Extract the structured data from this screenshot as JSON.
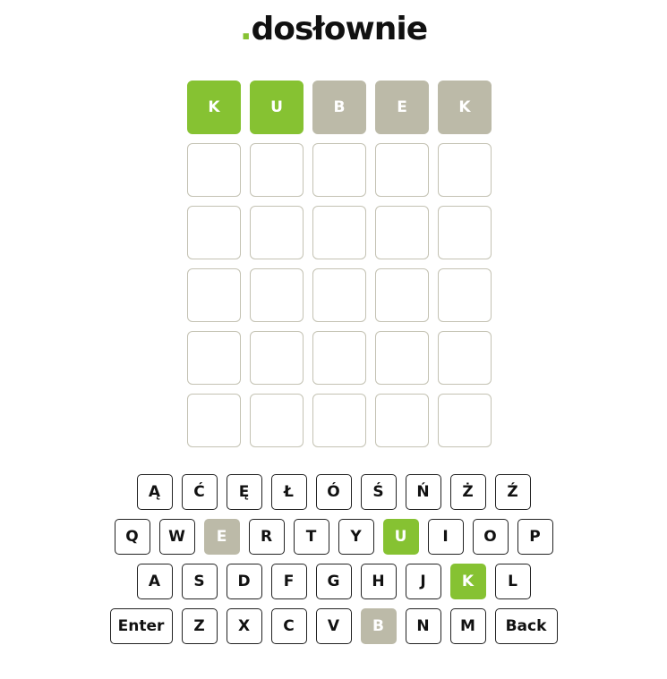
{
  "brand": {
    "dot": ".",
    "name": "dosłownie",
    "accent_color": "#86c232"
  },
  "colors": {
    "correct": "#86c232",
    "absent": "#bcbaa8",
    "empty_border": "#c4c2b3"
  },
  "board": {
    "rows": [
      [
        {
          "letter": "K",
          "state": "correct"
        },
        {
          "letter": "U",
          "state": "correct"
        },
        {
          "letter": "B",
          "state": "absent"
        },
        {
          "letter": "E",
          "state": "absent"
        },
        {
          "letter": "K",
          "state": "absent"
        }
      ],
      [
        {
          "letter": "",
          "state": "empty"
        },
        {
          "letter": "",
          "state": "empty"
        },
        {
          "letter": "",
          "state": "empty"
        },
        {
          "letter": "",
          "state": "empty"
        },
        {
          "letter": "",
          "state": "empty"
        }
      ],
      [
        {
          "letter": "",
          "state": "empty"
        },
        {
          "letter": "",
          "state": "empty"
        },
        {
          "letter": "",
          "state": "empty"
        },
        {
          "letter": "",
          "state": "empty"
        },
        {
          "letter": "",
          "state": "empty"
        }
      ],
      [
        {
          "letter": "",
          "state": "empty"
        },
        {
          "letter": "",
          "state": "empty"
        },
        {
          "letter": "",
          "state": "empty"
        },
        {
          "letter": "",
          "state": "empty"
        },
        {
          "letter": "",
          "state": "empty"
        }
      ],
      [
        {
          "letter": "",
          "state": "empty"
        },
        {
          "letter": "",
          "state": "empty"
        },
        {
          "letter": "",
          "state": "empty"
        },
        {
          "letter": "",
          "state": "empty"
        },
        {
          "letter": "",
          "state": "empty"
        }
      ],
      [
        {
          "letter": "",
          "state": "empty"
        },
        {
          "letter": "",
          "state": "empty"
        },
        {
          "letter": "",
          "state": "empty"
        },
        {
          "letter": "",
          "state": "empty"
        },
        {
          "letter": "",
          "state": "empty"
        }
      ]
    ]
  },
  "keyboard": {
    "rows": [
      [
        {
          "label": "Ą",
          "state": "default"
        },
        {
          "label": "Ć",
          "state": "default"
        },
        {
          "label": "Ę",
          "state": "default"
        },
        {
          "label": "Ł",
          "state": "default"
        },
        {
          "label": "Ó",
          "state": "default"
        },
        {
          "label": "Ś",
          "state": "default"
        },
        {
          "label": "Ń",
          "state": "default"
        },
        {
          "label": "Ż",
          "state": "default"
        },
        {
          "label": "Ź",
          "state": "default"
        }
      ],
      [
        {
          "label": "Q",
          "state": "default"
        },
        {
          "label": "W",
          "state": "default"
        },
        {
          "label": "E",
          "state": "absent"
        },
        {
          "label": "R",
          "state": "default"
        },
        {
          "label": "T",
          "state": "default"
        },
        {
          "label": "Y",
          "state": "default"
        },
        {
          "label": "U",
          "state": "correct"
        },
        {
          "label": "I",
          "state": "default"
        },
        {
          "label": "O",
          "state": "default"
        },
        {
          "label": "P",
          "state": "default"
        }
      ],
      [
        {
          "label": "A",
          "state": "default"
        },
        {
          "label": "S",
          "state": "default"
        },
        {
          "label": "D",
          "state": "default"
        },
        {
          "label": "F",
          "state": "default"
        },
        {
          "label": "G",
          "state": "default"
        },
        {
          "label": "H",
          "state": "default"
        },
        {
          "label": "J",
          "state": "default"
        },
        {
          "label": "K",
          "state": "correct"
        },
        {
          "label": "L",
          "state": "default"
        }
      ],
      [
        {
          "label": "Enter",
          "state": "default",
          "wide": true
        },
        {
          "label": "Z",
          "state": "default"
        },
        {
          "label": "X",
          "state": "default"
        },
        {
          "label": "C",
          "state": "default"
        },
        {
          "label": "V",
          "state": "default"
        },
        {
          "label": "B",
          "state": "absent"
        },
        {
          "label": "N",
          "state": "default"
        },
        {
          "label": "M",
          "state": "default"
        },
        {
          "label": "Back",
          "state": "default",
          "wide": true
        }
      ]
    ]
  }
}
